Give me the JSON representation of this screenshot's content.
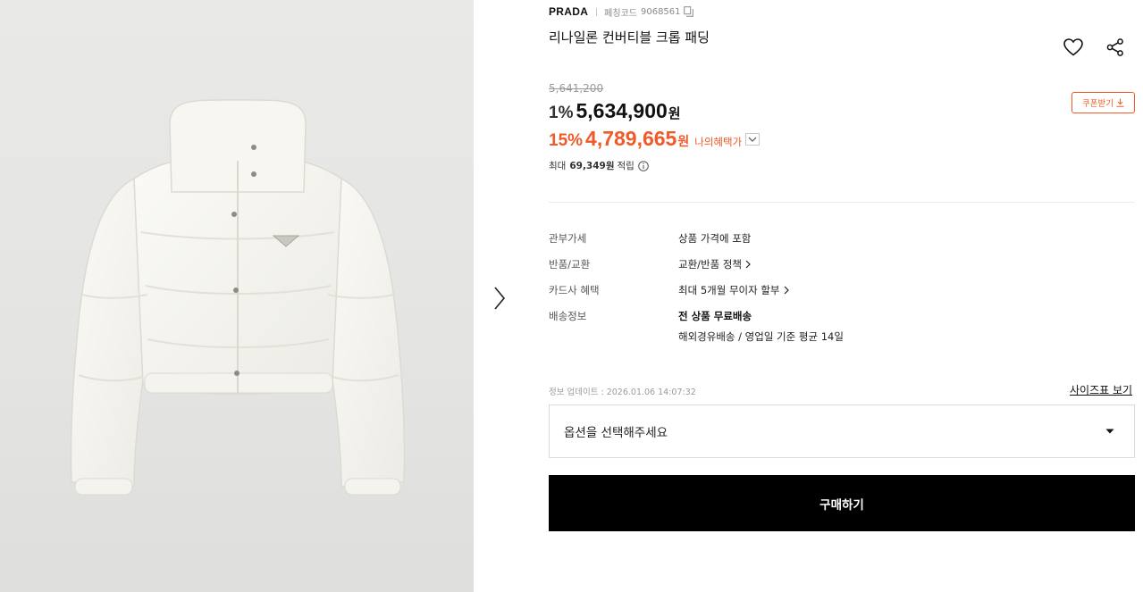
{
  "product": {
    "brand": "PRADA",
    "code_label": "페칭코드",
    "code": "9068561",
    "title": "리나일론 컨버티블 크롭 패딩",
    "image_alt": "white cropped puffer jacket with hood"
  },
  "pricing": {
    "original_price": "5,641,200",
    "discount_rate": "1%",
    "sale_price": "5,634,900",
    "currency": "원",
    "coupon_label": "쿠폰받기",
    "benefit_rate": "15%",
    "benefit_price": "4,789,665",
    "benefit_label": "나의혜택가",
    "points_prefix": "최대",
    "points_value": "69,349원",
    "points_suffix": "적립"
  },
  "details": [
    {
      "label": "관부가세",
      "value": "상품 가격에 포함",
      "link": false
    },
    {
      "label": "반품/교환",
      "value": "교환/반품 정책",
      "link": true
    },
    {
      "label": "카드사 혜택",
      "value": "최대 5개월 무이자 할부",
      "link": true
    },
    {
      "label": "배송정보",
      "value": "전 상품 무료배송",
      "value2": "해외경유배송 / 영업일 기준 평균 14일",
      "link": false
    }
  ],
  "update_info": "정보 업데이트 : 2026.01.06 14:07:32",
  "size_guide_label": "사이즈표 보기",
  "option_placeholder": "옵션을 선택해주세요",
  "buy_label": "구매하기",
  "colors": {
    "accent": "#f05a28",
    "buy_button": "#000000",
    "image_bg": "#e6e6e4"
  },
  "icons": {
    "wish": "heart-icon",
    "share": "share-icon",
    "copy": "copy-icon",
    "download": "download-icon",
    "info": "info-icon",
    "next": "chevron-right-icon",
    "dropdown": "caret-down-icon"
  }
}
